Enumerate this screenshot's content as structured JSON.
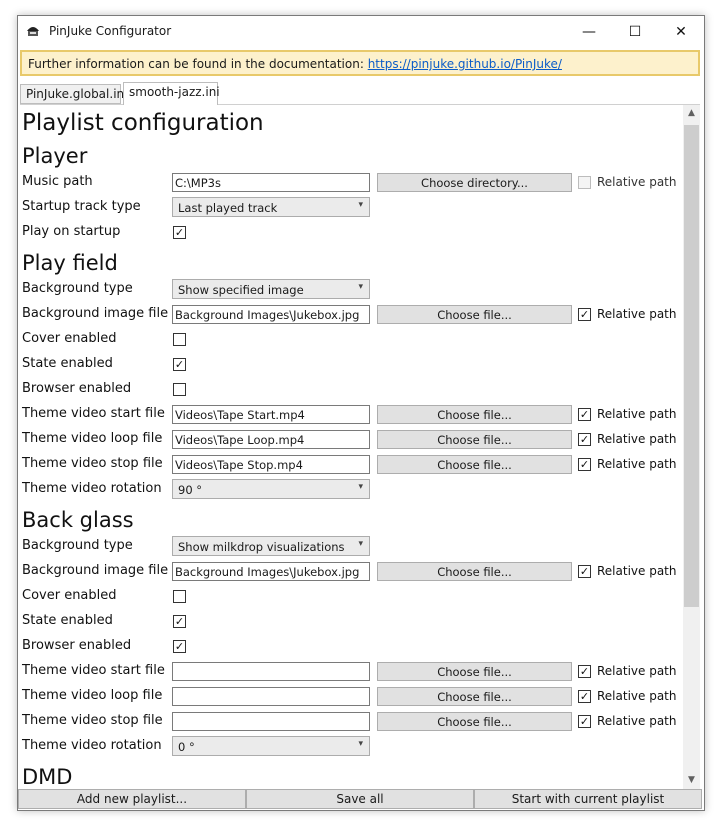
{
  "window": {
    "title": "PinJuke Configurator",
    "icon": "jukebox-icon",
    "minimize_glyph": "—",
    "maximize_glyph": "☐",
    "close_glyph": "✕"
  },
  "info_bar": {
    "text": "Further information can be found in the documentation: ",
    "link": "https://pinjuke.github.io/PinJuke/"
  },
  "tabs": [
    {
      "label": "PinJuke.global.ini",
      "active": false
    },
    {
      "label": "smooth-jazz.ini",
      "active": true
    }
  ],
  "page_title": "Playlist configuration",
  "relative_path_label": "Relative path",
  "choose_directory_label": "Choose directory...",
  "choose_file_label": "Choose file...",
  "player": {
    "heading": "Player",
    "music_path": {
      "label": "Music path",
      "value": "C:\\MP3s",
      "relative": false
    },
    "startup_track_type": {
      "label": "Startup track type",
      "value": "Last played track"
    },
    "play_on_startup": {
      "label": "Play on startup",
      "checked": true
    }
  },
  "play_field": {
    "heading": "Play field",
    "background_type": {
      "label": "Background type",
      "value": "Show specified image"
    },
    "background_image_file": {
      "label": "Background image file",
      "value": "Background Images\\Jukebox.jpg",
      "relative": true
    },
    "cover_enabled": {
      "label": "Cover enabled",
      "checked": false
    },
    "state_enabled": {
      "label": "State enabled",
      "checked": true
    },
    "browser_enabled": {
      "label": "Browser enabled",
      "checked": false
    },
    "theme_video_start_file": {
      "label": "Theme video start file",
      "value": "Videos\\Tape Start.mp4",
      "relative": true
    },
    "theme_video_loop_file": {
      "label": "Theme video loop file",
      "value": "Videos\\Tape Loop.mp4",
      "relative": true
    },
    "theme_video_stop_file": {
      "label": "Theme video stop file",
      "value": "Videos\\Tape Stop.mp4",
      "relative": true
    },
    "theme_video_rotation": {
      "label": "Theme video rotation",
      "value": "90 °"
    }
  },
  "back_glass": {
    "heading": "Back glass",
    "background_type": {
      "label": "Background type",
      "value": "Show milkdrop visualizations"
    },
    "background_image_file": {
      "label": "Background image file",
      "value": "Background Images\\Jukebox.jpg",
      "relative": true
    },
    "cover_enabled": {
      "label": "Cover enabled",
      "checked": false
    },
    "state_enabled": {
      "label": "State enabled",
      "checked": true
    },
    "browser_enabled": {
      "label": "Browser enabled",
      "checked": true
    },
    "theme_video_start_file": {
      "label": "Theme video start file",
      "value": "",
      "relative": true
    },
    "theme_video_loop_file": {
      "label": "Theme video loop file",
      "value": "",
      "relative": true
    },
    "theme_video_stop_file": {
      "label": "Theme video stop file",
      "value": "",
      "relative": true
    },
    "theme_video_rotation": {
      "label": "Theme video rotation",
      "value": "0 °"
    }
  },
  "dmd": {
    "heading": "DMD"
  },
  "footer": {
    "add_playlist": "Add new playlist...",
    "save_all": "Save all",
    "start_playlist": "Start with current playlist"
  },
  "check_glyph": "✓",
  "dropdown_glyph": "▾"
}
